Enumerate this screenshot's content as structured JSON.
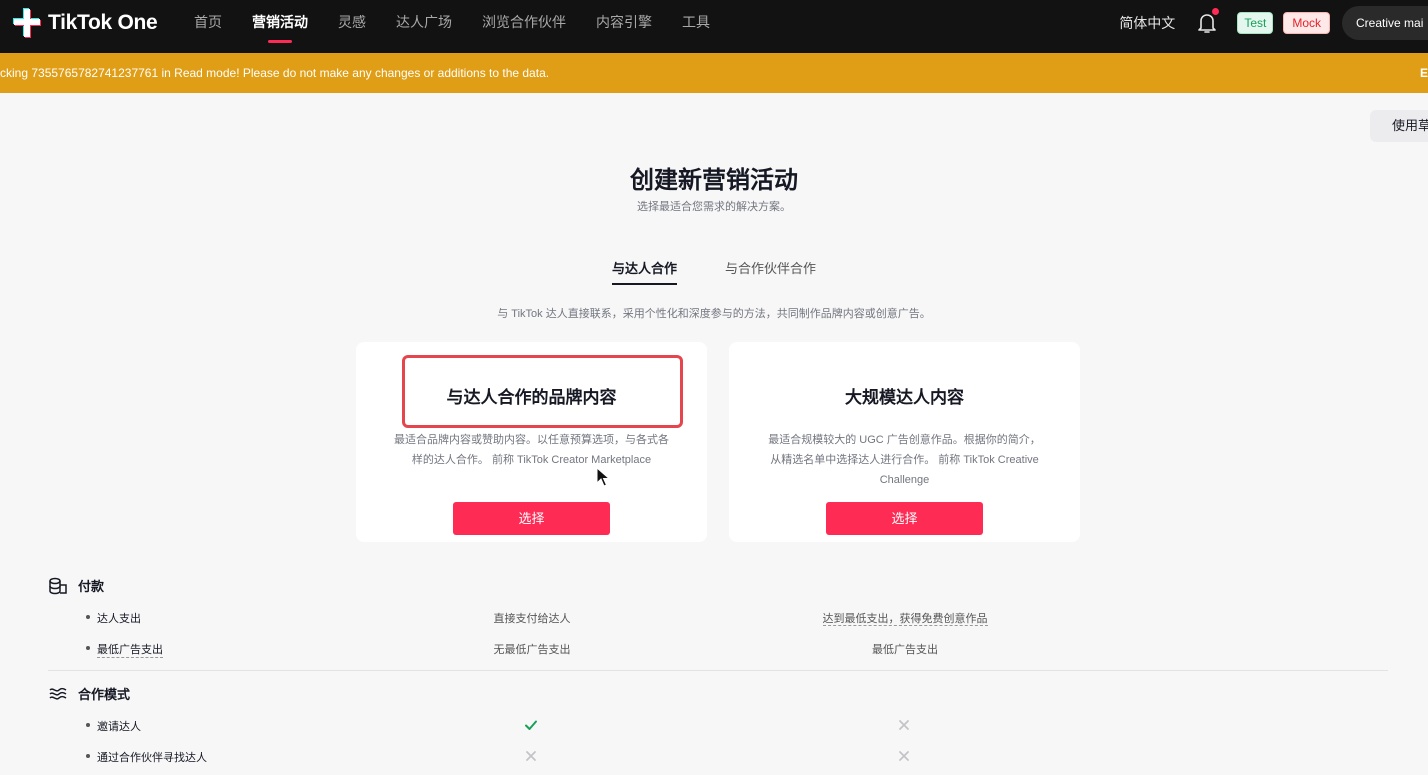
{
  "header": {
    "logo_text": "TikTok One",
    "nav": [
      {
        "label": "首页",
        "active": false
      },
      {
        "label": "营销活动",
        "active": true
      },
      {
        "label": "灵感",
        "active": false
      },
      {
        "label": "达人广场",
        "active": false
      },
      {
        "label": "浏览合作伙伴",
        "active": false
      },
      {
        "label": "内容引擎",
        "active": false
      },
      {
        "label": "工具",
        "active": false
      }
    ],
    "language": "简体中文",
    "tag_test": "Test",
    "tag_mock": "Mock",
    "account": "Creative mai"
  },
  "banner": {
    "text": "cking 7355765782741237761 in Read mode! Please do not make any changes or additions to the data.",
    "exit": "E"
  },
  "guide_button": "使用草",
  "page": {
    "title": "创建新营销活动",
    "subtitle": "选择最适合您需求的解决方案。"
  },
  "tabs": [
    {
      "label": "与达人合作",
      "active": true
    },
    {
      "label": "与合作伙伴合作",
      "active": false
    }
  ],
  "tab_description": "与 TikTok 达人直接联系，采用个性化和深度参与的方法，共同制作品牌内容或创意广告。",
  "cards": [
    {
      "title": "与达人合作的品牌内容",
      "description": "最适合品牌内容或赞助内容。以任意预算选项，与各式各样的达人合作。 前称 TikTok Creator Marketplace",
      "button": "选择"
    },
    {
      "title": "大规模达人内容",
      "description": "最适合规模较大的 UGC 广告创意作品。根据你的简介，从精选名单中选择达人进行合作。 前称 TikTok Creative Challenge",
      "button": "选择"
    }
  ],
  "comparison": {
    "payment": {
      "heading": "付款",
      "icon": "coins-icon",
      "rows": [
        {
          "label": "达人支出",
          "col1": "直接支付给达人",
          "col2": "达到最低支出，获得免费创意作品"
        },
        {
          "label": "最低广告支出",
          "col1": "无最低广告支出",
          "col2": "最低广告支出"
        }
      ]
    },
    "collaboration": {
      "heading": "合作模式",
      "icon": "layers-icon",
      "rows": [
        {
          "label": "邀请达人",
          "col1": "check",
          "col2": "cross"
        },
        {
          "label": "通过合作伙伴寻找达人",
          "col1": "cross",
          "col2": "cross"
        }
      ]
    }
  },
  "colors": {
    "brand": "#fe2c55",
    "banner": "#e09e16",
    "highlight": "#e5454d",
    "check": "#18a058"
  }
}
